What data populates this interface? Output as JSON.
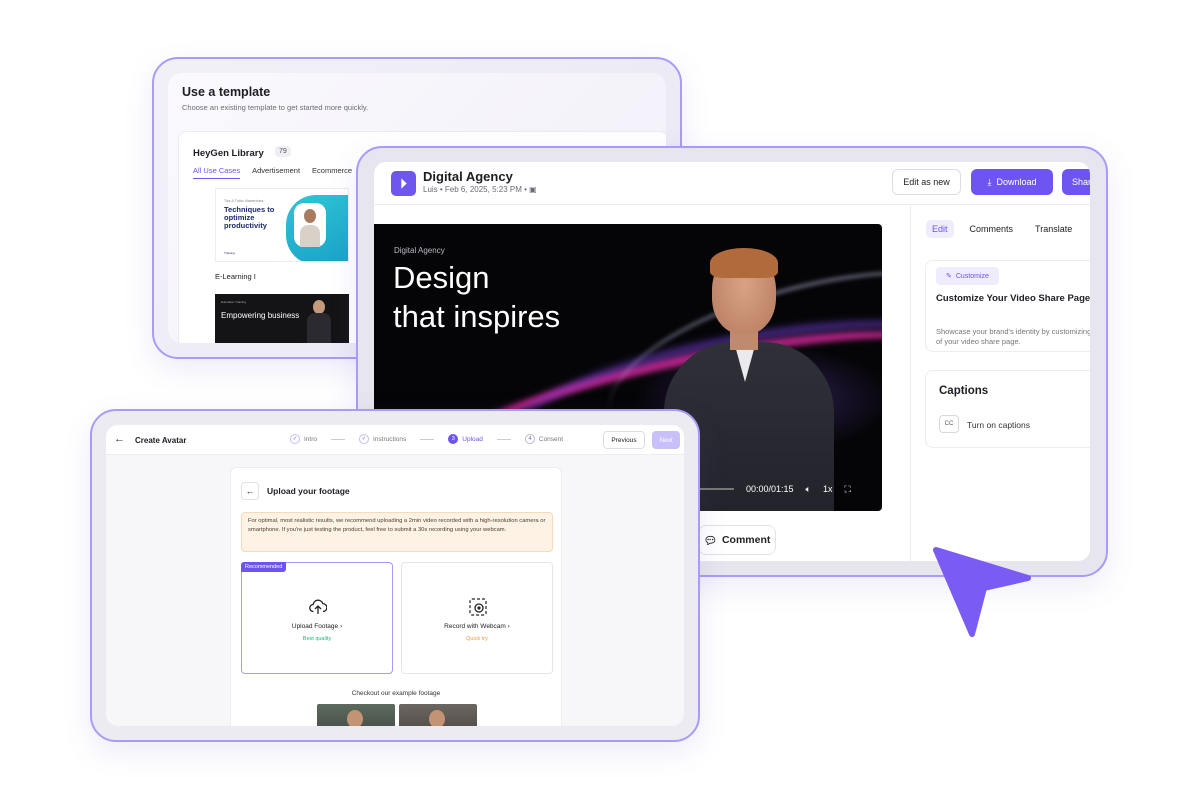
{
  "template": {
    "title": "Use a template",
    "subtitle": "Choose an existing template to get started more quickly.",
    "library_name": "HeyGen Library",
    "library_count": "79",
    "tabs": [
      "All Use Cases",
      "Advertisement",
      "Ecommerce"
    ],
    "thumb1_header": "Tips & Tricks Masterclass",
    "thumb1_text": "Techniques to optimize productivity",
    "thumb1_footer": "Training",
    "thumb1_label": "E-Learning I",
    "thumb2_header": "Education Training",
    "thumb2_text": "Empowering business"
  },
  "video": {
    "title": "Digital Agency",
    "meta": "Luis • Feb 6, 2025, 5:23 PM •",
    "edit_as_new": "Edit as new",
    "download": "Download",
    "share": "Share",
    "player_label": "Digital Agency",
    "headline_1": "Design",
    "headline_2": "that inspires",
    "time": "00:00/01:15",
    "speed": "1x",
    "comment": "Comment",
    "side_tabs": [
      "Edit",
      "Comments",
      "Translate"
    ],
    "customize_chip": "Customize",
    "customize_title": "Customize Your Video Share Page",
    "customize_desc": "Showcase your brand's identity by customizing every detail of your video share page.",
    "captions_title": "Captions",
    "captions_toggle": "Turn on captions",
    "cc": "CC",
    "accent": "#6e55f2"
  },
  "avatar": {
    "title": "Create Avatar",
    "steps": [
      {
        "num": "✓",
        "label": "Intro"
      },
      {
        "num": "✓",
        "label": "Instructions"
      },
      {
        "num": "3",
        "label": "Upload"
      },
      {
        "num": "4",
        "label": "Consent"
      }
    ],
    "previous": "Previous",
    "next": "Next",
    "upload_title": "Upload your footage",
    "note": "For optimal, most realistic results, we recommend uploading a 2min video recorded with a high-resolution camera or smartphone. If you're just testing the product, feel free to submit a 30s recording using your webcam.",
    "recommended": "Recommended",
    "upload_label": "Upload Footage",
    "upload_sub": "Best quality",
    "webcam_label": "Record with Webcam",
    "webcam_sub": "Quick try",
    "example_label": "Checkout our example footage"
  }
}
